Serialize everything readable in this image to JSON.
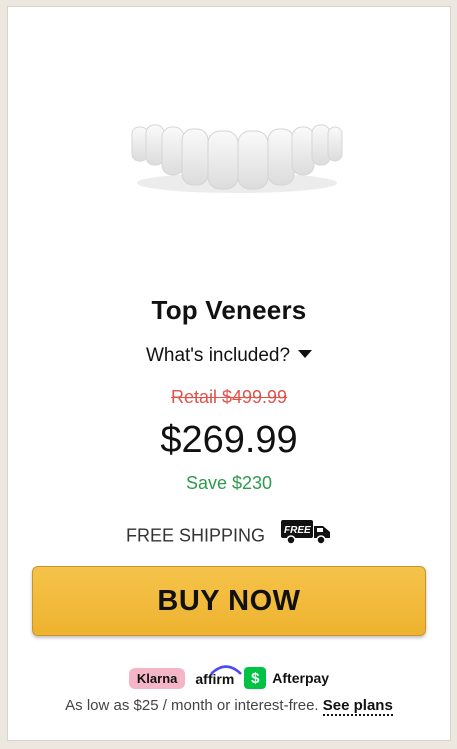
{
  "product": {
    "title": "Top Veneers",
    "whats_included": "What's included?",
    "retail_price": "Retail $499.99",
    "price": "$269.99",
    "savings": "Save $230",
    "shipping_label": "FREE SHIPPING",
    "shipping_badge": "FREE"
  },
  "buy_button": {
    "label": "BUY NOW"
  },
  "payment": {
    "klarna": "Klarna",
    "affirm": "affirm",
    "afterpay": "Afterpay",
    "afterpay_symbol": "$",
    "plans_text": "As low as $25 / month or interest-free.",
    "see_plans": "See plans"
  },
  "colors": {
    "buy_button": "#f0b73a",
    "retail_strike": "#e0524a",
    "savings": "#2e9a4d",
    "klarna_bg": "#f4b6c7",
    "afterpay_bg": "#00c244"
  }
}
